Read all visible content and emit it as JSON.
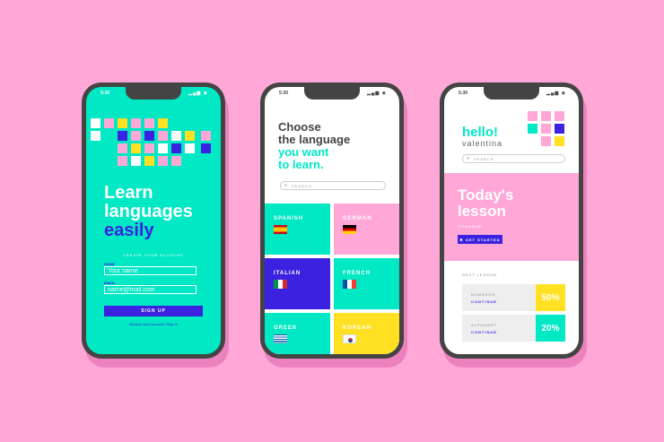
{
  "colors": {
    "background": "#ffa8d8",
    "teal": "#00e8c4",
    "blue": "#3b22e0",
    "pink": "#ffa8d8",
    "yellow": "#ffe022",
    "dark": "#444444"
  },
  "status_time": "5:30",
  "phone1": {
    "title_line1": "Learn",
    "title_line2": "languages",
    "title_line3": "easily",
    "subtitle": "CREATE YOUR ACCOUNT",
    "name_label": "NAME",
    "name_placeholder": "Your name",
    "email_label": "EMAIL",
    "email_placeholder": "name@mail.com",
    "signup_label": "SIGN UP",
    "footer": "Already have account? Sign in"
  },
  "phone2": {
    "title_line1": "Choose",
    "title_line2": "the language",
    "title_line3": "you want",
    "title_line4": "to learn.",
    "search_placeholder": "SEARCH",
    "languages": [
      {
        "name": "SPANISH",
        "flag": "spain-flag-icon"
      },
      {
        "name": "GERMAN",
        "flag": "germany-flag-icon"
      },
      {
        "name": "ITALIAN",
        "flag": "italy-flag-icon"
      },
      {
        "name": "FRENCH",
        "flag": "france-flag-icon"
      },
      {
        "name": "GREEK",
        "flag": "greece-flag-icon"
      },
      {
        "name": "KOREAN",
        "flag": "korea-flag-icon"
      }
    ]
  },
  "phone3": {
    "hello": "hello!",
    "name": "valentina",
    "search_placeholder": "SEARCH",
    "today_line1": "Today's",
    "today_line2": "lesson",
    "grammar": "GRAMMAR",
    "get_started": "GET STARTED",
    "next_lesson": "NEXT LESSON",
    "lessons": [
      {
        "title": "NUMBERS",
        "action": "CONTINUE",
        "percent": "50%"
      },
      {
        "title": "ALPHABET",
        "action": "CONTINUE",
        "percent": "20%"
      }
    ]
  }
}
